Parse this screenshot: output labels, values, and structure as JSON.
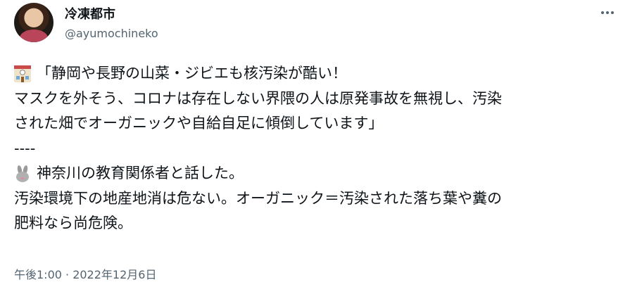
{
  "author": {
    "display_name": "冷凍都市",
    "handle": "@ayumochineko"
  },
  "icons": {
    "more": "more-horizontal-icon",
    "emoji_1": "school-emoji-icon",
    "emoji_2": "rabbit-emoji-icon"
  },
  "tweet": {
    "line1": "「静岡や長野の山菜・ジビエも核汚染が酷い！",
    "line2": "マスクを外そう、コロナは存在しない界隈の人は原発事故を無視し、汚染",
    "line3": "された畑でオーガニックや自給自足に傾倒しています」",
    "line4": "----",
    "line5": "神奈川の教育関係者と話した。",
    "line6": "汚染環境下の地産地消は危ない。オーガニック＝汚染された落ち葉や糞の",
    "line7": "肥料なら尚危険。"
  },
  "timestamp": "午後1:00 · 2022年12月6日",
  "colors": {
    "text_primary": "#0f1419",
    "text_secondary": "#536471",
    "background": "#ffffff"
  }
}
